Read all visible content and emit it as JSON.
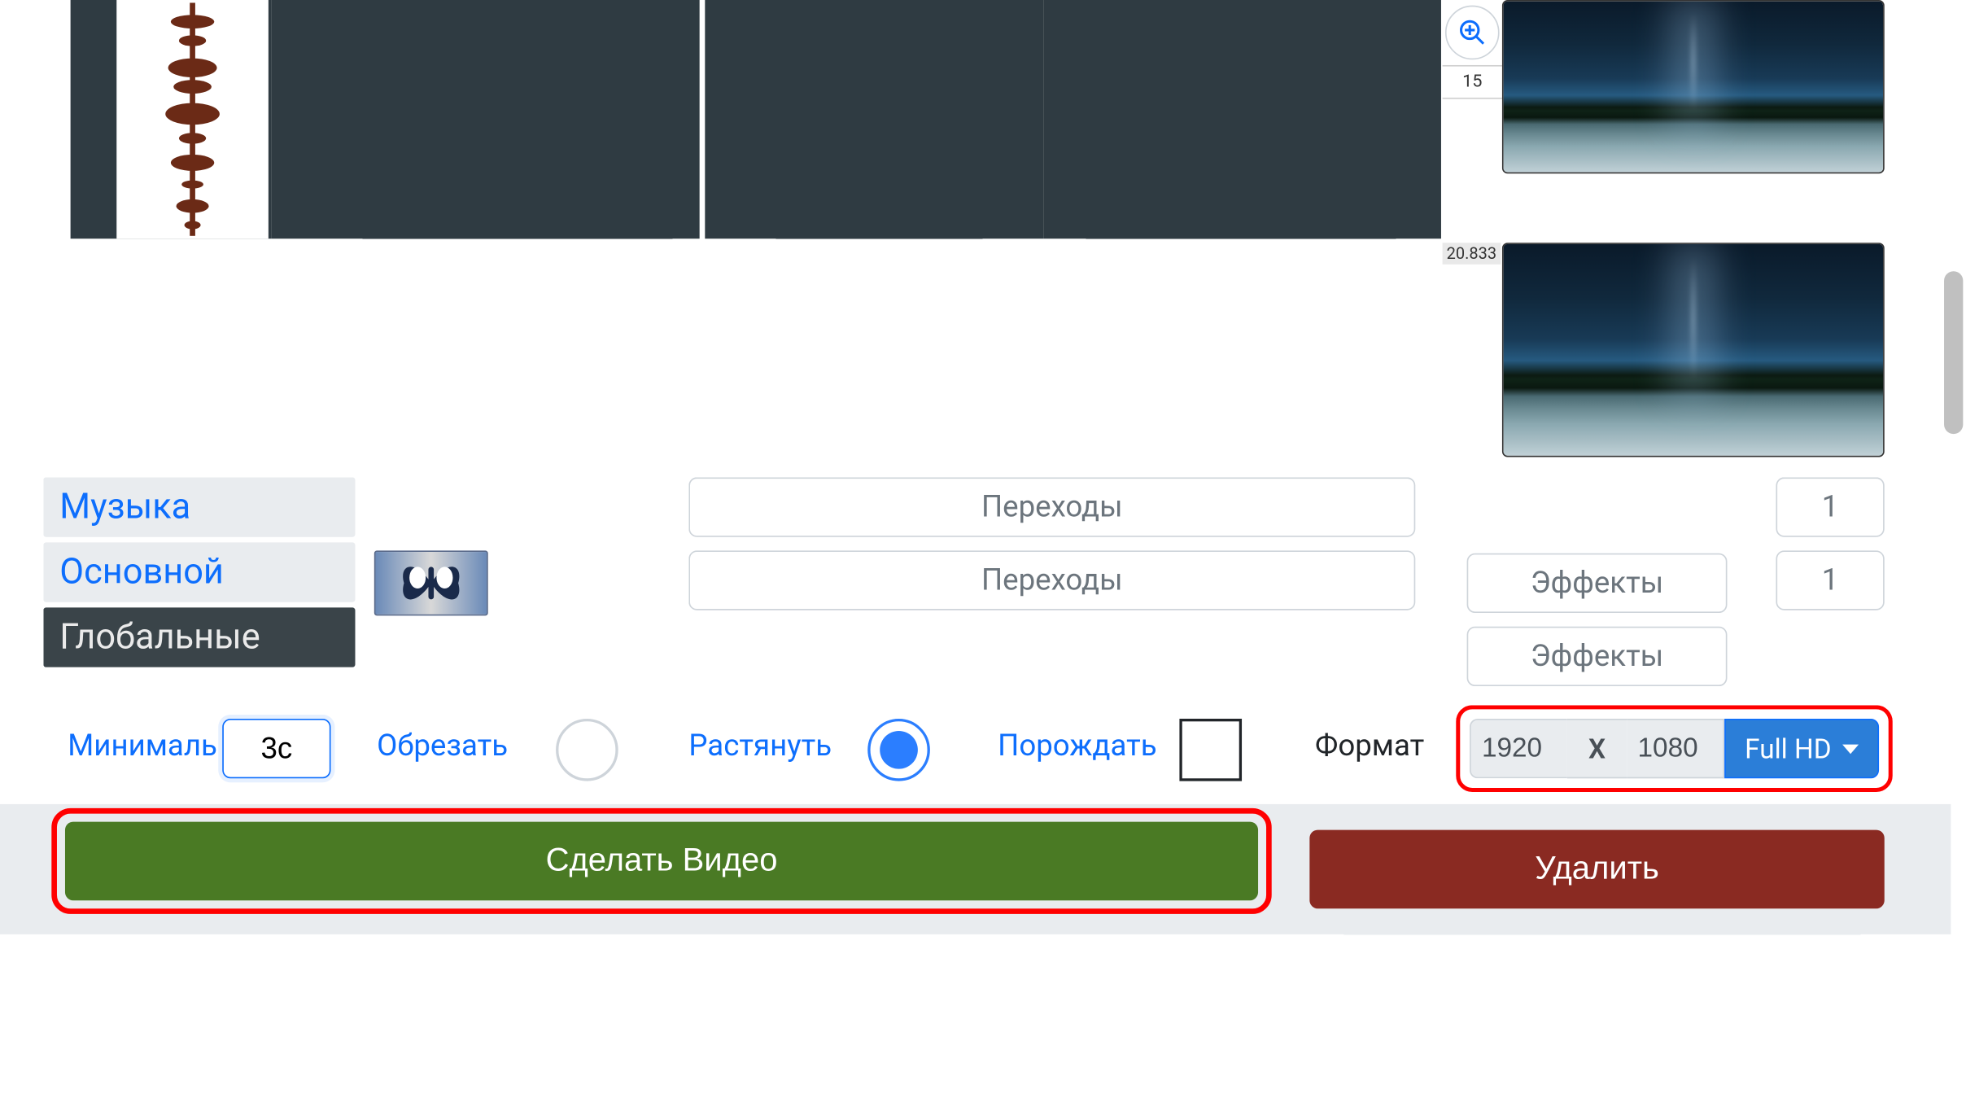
{
  "zoom": {
    "tick": "15"
  },
  "thumbnails": {
    "ts2": "20.833"
  },
  "layers": {
    "music": "Музыка",
    "main": "Основной",
    "global": "Глобальные"
  },
  "transitions": {
    "label": "Переходы",
    "count1": "1",
    "count2": "1"
  },
  "effects": {
    "label": "Эффекты"
  },
  "options": {
    "min_label": "Минималь",
    "min_value": "3с",
    "crop_label": "Обрезать",
    "stretch_label": "Растянуть",
    "spawn_label": "Порождать",
    "format_label": "Формат",
    "width": "1920",
    "x": "X",
    "height": "1080",
    "preset": "Full HD"
  },
  "actions": {
    "make": "Сделать Видео",
    "delete": "Удалить"
  }
}
